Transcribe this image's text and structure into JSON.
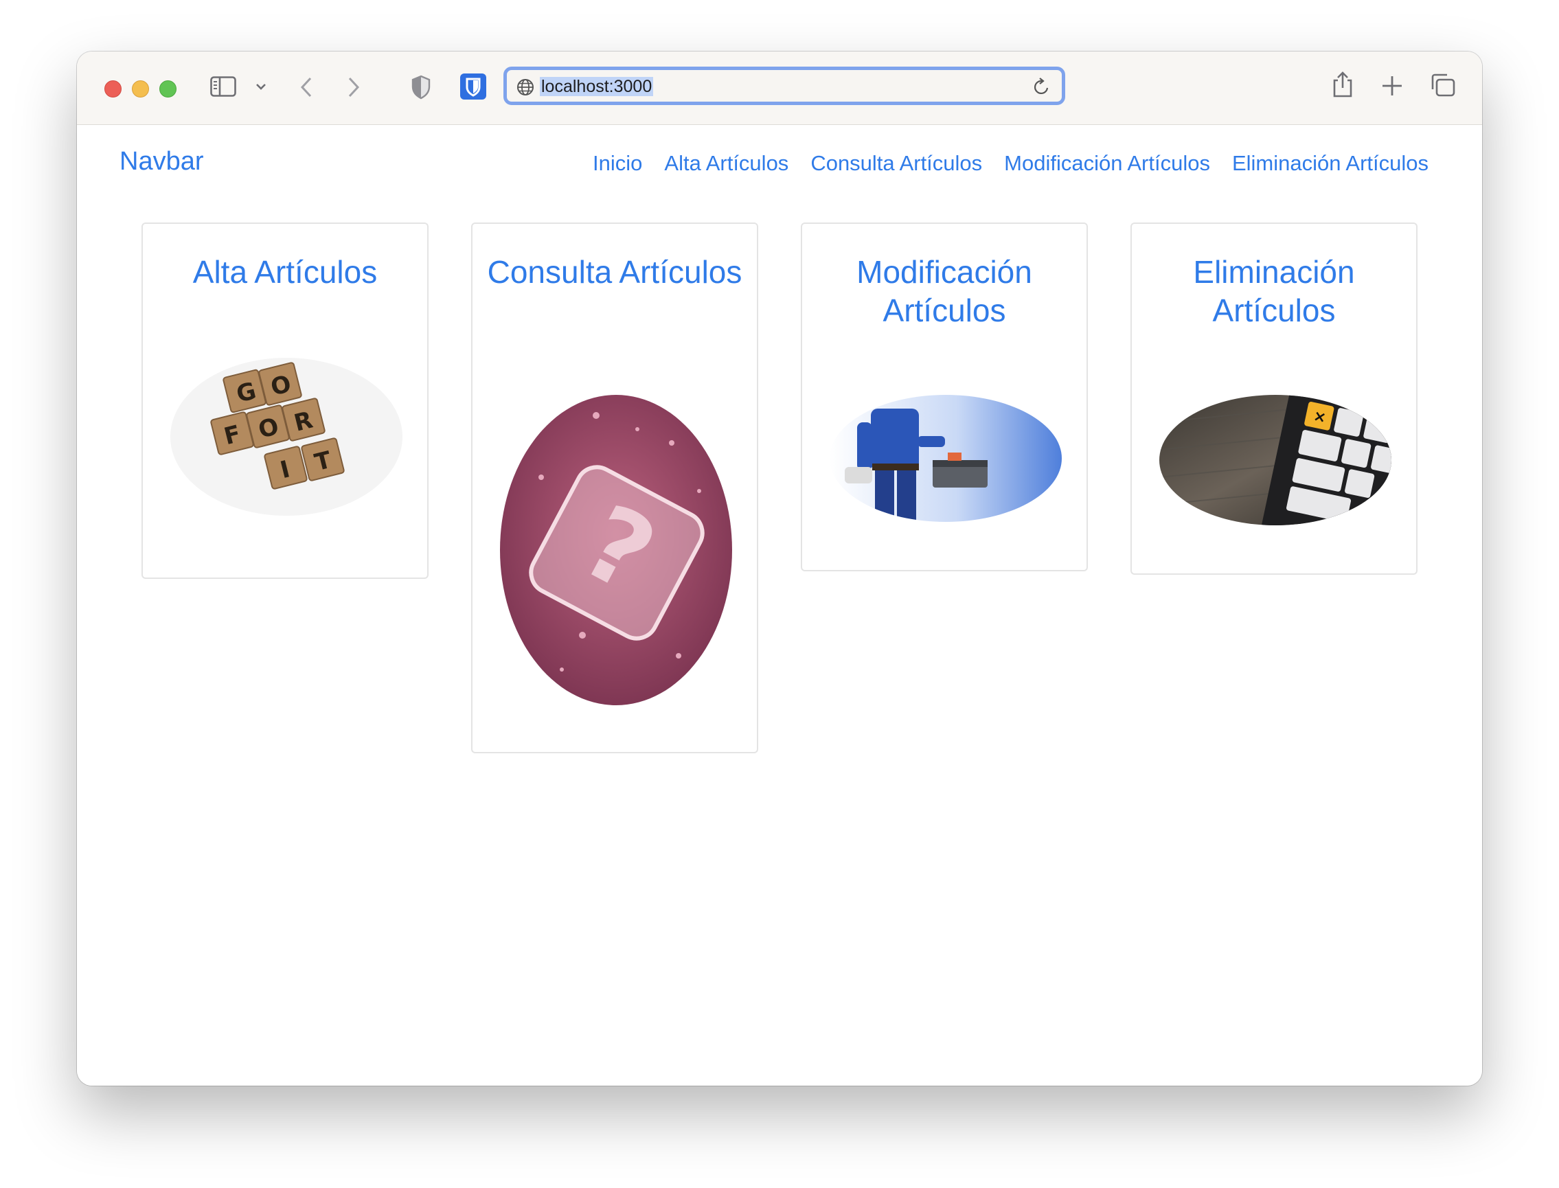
{
  "browser": {
    "url": "localhost:3000"
  },
  "navbar": {
    "brand": "Navbar",
    "links": [
      "Inicio",
      "Alta Artículos",
      "Consulta Artículos",
      "Modificación Artículos",
      "Eliminación Artículos"
    ]
  },
  "cards": [
    {
      "title": "Alta Artículos",
      "image": "scrabble-go-for-it-image"
    },
    {
      "title": "Consulta Artículos",
      "image": "question-mark-glass-image"
    },
    {
      "title": "Modificación Artículos",
      "image": "repairman-toolbox-image"
    },
    {
      "title": "Eliminación Artículos",
      "image": "keyboard-delete-key-image"
    }
  ],
  "colors": {
    "link": "#2f7be8",
    "url_focus_ring": "#7fa3ec"
  }
}
